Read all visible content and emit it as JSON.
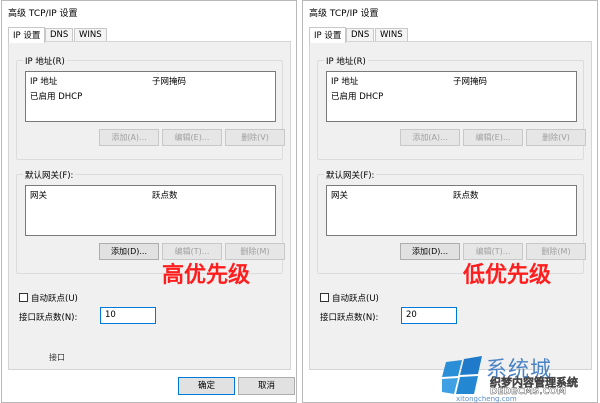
{
  "dialogs": [
    {
      "title": "高级 TCP/IP 设置",
      "tabs": [
        "IP 设置",
        "DNS",
        "WINS"
      ],
      "ip_group": {
        "legend": "IP 地址(R)",
        "col_ip": "IP 地址",
        "col_mask": "子网掩码",
        "row": "已启用 DHCP",
        "buttons": [
          "添加(A)...",
          "编辑(E)...",
          "删除(V)"
        ]
      },
      "gateway_group": {
        "legend": "默认网关(F):",
        "col_gw": "网关",
        "col_metric": "跃点数",
        "buttons": [
          "添加(D)...",
          "编辑(T)...",
          "删除(M)"
        ]
      },
      "auto_metric_label": "自动跃点(U)",
      "interface_metric_label": "接口跃点数(N):",
      "interface_metric_value": "10",
      "annotation": "高优先级",
      "partial_text": "接口",
      "ok_label": "确定",
      "cancel_label": "取消"
    },
    {
      "title": "高级 TCP/IP 设置",
      "tabs": [
        "IP 设置",
        "DNS",
        "WINS"
      ],
      "ip_group": {
        "legend": "IP 地址(R)",
        "col_ip": "IP 地址",
        "col_mask": "子网掩码",
        "row": "已启用 DHCP",
        "buttons": [
          "添加(A)...",
          "编辑(E)...",
          "删除(V)"
        ]
      },
      "gateway_group": {
        "legend": "默认网关(F):",
        "col_gw": "网关",
        "col_metric": "跃点数",
        "buttons": [
          "添加(D)...",
          "编辑(T)...",
          "删除(M)"
        ]
      },
      "auto_metric_label": "自动跃点(U)",
      "interface_metric_label": "接口跃点数(N):",
      "interface_metric_value": "20",
      "annotation": "低优先级"
    }
  ],
  "watermark": {
    "big": "系统城",
    "sub": "织梦内容管理系统",
    "url": "DEDECMS.COM",
    "url2": "xitongcheng.com"
  },
  "colors": {
    "annotation": "#ff1e1e",
    "focus_border": "#0078d7",
    "watermark_blue": "#4a83c4"
  }
}
